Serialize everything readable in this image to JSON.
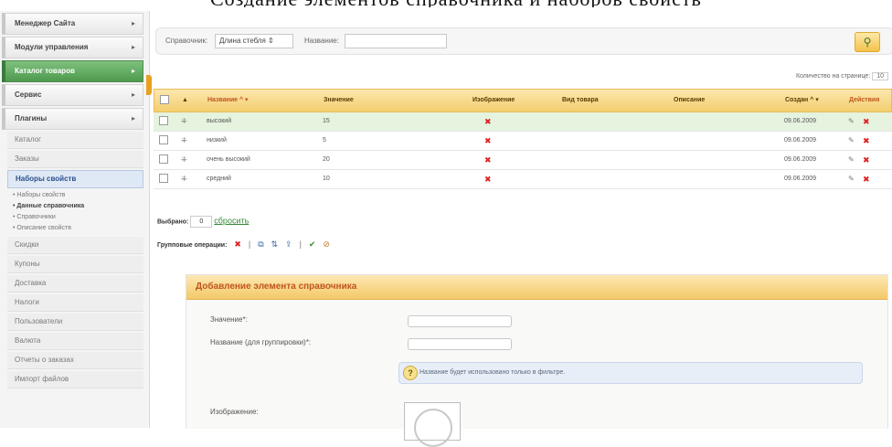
{
  "caption": "Создание элементов справочника и наборов свойств",
  "sidebar": {
    "items": [
      {
        "label": "Менеджер Сайта",
        "arrow": "▸"
      },
      {
        "label": "Модули управления",
        "arrow": "▸"
      },
      {
        "label": "Каталог товаров",
        "arrow": "▸"
      },
      {
        "label": "Сервис",
        "arrow": "▸"
      },
      {
        "label": "Плагины",
        "arrow": "▸"
      }
    ],
    "sub": [
      "Каталог",
      "Заказы"
    ],
    "selected": "Наборы свойств",
    "subsub": [
      "Наборы свойств",
      "Данные справочника",
      "Справочники",
      "Описание свойств"
    ],
    "more": [
      "Скидки",
      "Купоны",
      "Доставка",
      "Налоги",
      "Пользователи",
      "Валюта",
      "Отчеты о заказах",
      "Импорт файлов"
    ]
  },
  "filter": {
    "dict_label": "Справочник:",
    "dict_value": "Длина стебля",
    "name_label": "Название:",
    "perpage_label": "Количество на странице:",
    "perpage_value": "10"
  },
  "table": {
    "headers": [
      "Название",
      "Значение",
      "Изображение",
      "Вид товара",
      "Описание",
      "Создан",
      "Действия"
    ],
    "rows": [
      {
        "name": "высокий",
        "value": "15",
        "created": "09.06.2009"
      },
      {
        "name": "низкий",
        "value": "5",
        "created": "09.06.2009"
      },
      {
        "name": "очень высокий",
        "value": "20",
        "created": "09.06.2009"
      },
      {
        "name": "средний",
        "value": "10",
        "created": "09.06.2009"
      }
    ]
  },
  "selection": {
    "label": "Выбрано:",
    "count": "0",
    "reset": "сбросить"
  },
  "group": {
    "label": "Групповые операции:"
  },
  "form": {
    "title": "Добавление элемента справочника",
    "value_label": "Значение*:",
    "groupname_label": "Название (для группировки)*:",
    "hint": "Название будет использовано только в фильтре.",
    "image_label": "Изображение:"
  },
  "colors": {
    "accent": "#c0551d",
    "active_menu": "#5aa25a",
    "header_bg": "#f3cf6f"
  }
}
